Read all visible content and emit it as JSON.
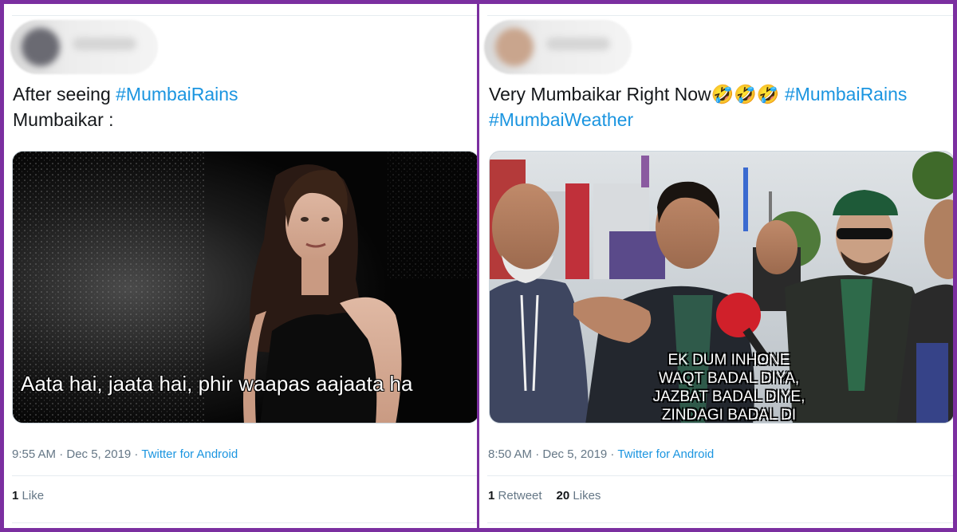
{
  "tweets": [
    {
      "text_line1": "After seeing ",
      "hashtag1": "#MumbaiRains",
      "text_line2": "Mumbaikar :",
      "media_caption": "Aata hai, jaata hai, phir waapas aajaata ha",
      "time": "9:55 AM · Dec 5, 2019 · ",
      "source": "Twitter for Android",
      "likes_count": "1",
      "likes_label": "Like"
    },
    {
      "text_line1": "Very Mumbaikar Right Now🤣🤣🤣 ",
      "hashtag1": "#MumbaiRains",
      "hashtag2": "#MumbaiWeather",
      "media_caption_lines": [
        "EK DUM INHONE",
        "WAQT BADAL DIYA,",
        "JAZBAT BADAL DIYE,",
        "ZINDAGI BADAL DI"
      ],
      "time": "8:50 AM · Dec 5, 2019 · ",
      "source": "Twitter for Android",
      "retweets_count": "1",
      "retweets_label": "Retweet",
      "likes_count": "20",
      "likes_label": "Likes"
    }
  ],
  "colors": {
    "frame": "#7b2fa0",
    "hashtag": "#1b95e0",
    "meta": "#657786",
    "text": "#14171a"
  }
}
